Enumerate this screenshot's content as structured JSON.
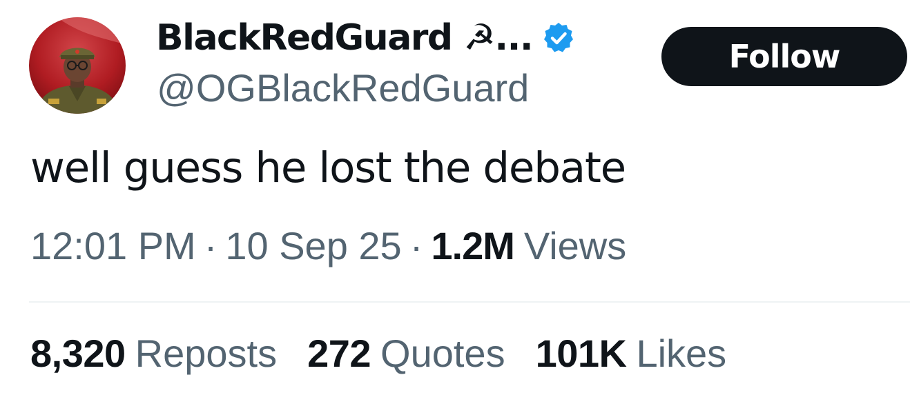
{
  "author": {
    "display_name": "BlackRedGuard ☭...",
    "handle": "@OGBlackRedGuard",
    "verified_icon": "verified-badge-icon",
    "avatar_icon": "profile-avatar"
  },
  "follow_button": {
    "label": "Follow"
  },
  "tweet": {
    "text": "well guess he lost the debate"
  },
  "meta": {
    "time": "12:01 PM",
    "separator": "·",
    "date": "10 Sep 25",
    "views_count": "1.2M",
    "views_label": "Views"
  },
  "stats": {
    "reposts_count": "8,320",
    "reposts_label": "Reposts",
    "quotes_count": "272",
    "quotes_label": "Quotes",
    "likes_count": "101K",
    "likes_label": "Likes"
  },
  "colors": {
    "text_primary": "#0f1419",
    "text_secondary": "#536471",
    "verified_blue": "#1d9bf0",
    "divider": "#eff3f4",
    "button_bg": "#0f1419"
  }
}
